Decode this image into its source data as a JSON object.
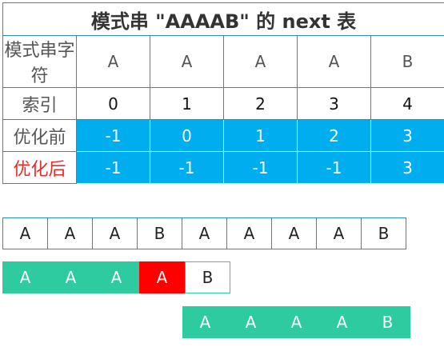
{
  "table": {
    "title": "模式串 \"AAAAB\" 的 next 表",
    "rows": [
      {
        "label": "模式串字符",
        "style": "hdr",
        "values": [
          "A",
          "A",
          "A",
          "A",
          "B"
        ]
      },
      {
        "label": "索引",
        "style": "plain",
        "values": [
          "0",
          "1",
          "2",
          "3",
          "4"
        ]
      },
      {
        "label": "优化前",
        "style": "blue",
        "values": [
          "-1",
          "0",
          "1",
          "2",
          "3"
        ]
      },
      {
        "label": "优化后",
        "style": "blue-red",
        "values": [
          "-1",
          "-1",
          "-1",
          "-1",
          "3"
        ]
      }
    ]
  },
  "text_string": [
    "A",
    "A",
    "A",
    "B",
    "A",
    "A",
    "A",
    "A",
    "B"
  ],
  "pattern_row1": [
    {
      "char": "A",
      "state": "match"
    },
    {
      "char": "A",
      "state": "match"
    },
    {
      "char": "A",
      "state": "match"
    },
    {
      "char": "A",
      "state": "mismatch"
    },
    {
      "char": "B",
      "state": "pending"
    }
  ],
  "pattern_row2": [
    "A",
    "A",
    "A",
    "A",
    "B"
  ],
  "colors": {
    "border": "#2e86d6",
    "blue": "#00aeef",
    "green": "#2ecba0",
    "mismatch": "#ff0000",
    "label_red": "#e82b2b"
  }
}
